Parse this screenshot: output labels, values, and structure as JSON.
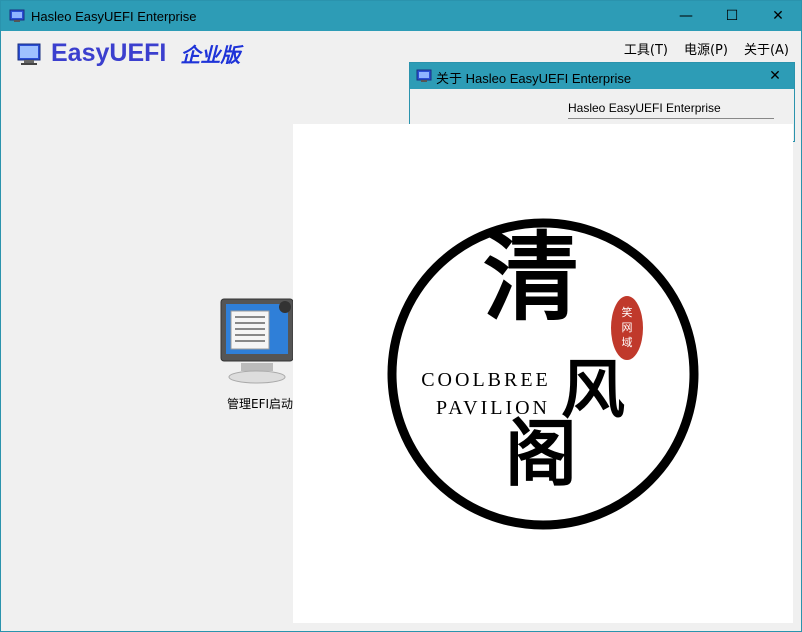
{
  "window": {
    "title": "Hasleo EasyUEFI Enterprise",
    "controls": {
      "minimize": "—",
      "maximize": "☐",
      "close": "✕"
    }
  },
  "brand": {
    "name": "EasyUEFI",
    "edition": "企业版",
    "icon": "easyuefi-logo-icon"
  },
  "menubar": {
    "items": [
      {
        "label": "工具(T)"
      },
      {
        "label": "电源(P)"
      },
      {
        "label": "关于(A)"
      }
    ]
  },
  "main": {
    "manage_efi_label": "管理EFI启动"
  },
  "about_dialog": {
    "title": "关于 Hasleo EasyUEFI Enterprise",
    "product_name": "Hasleo EasyUEFI Enterprise",
    "close": "✕"
  },
  "watermark": {
    "title_char_1": "清",
    "title_char_2": "风",
    "title_char_3": "阁",
    "english_line_1": "COOLBREE",
    "english_line_2": "PAVILION",
    "seal_text": "笑网域",
    "colors": {
      "ring": "#000000",
      "seal": "#c0392b"
    }
  },
  "colors": {
    "titlebar": "#2d9cb6",
    "brand": "#3b3fce",
    "edition": "#1e33d8",
    "client": "#f0f0f0"
  }
}
